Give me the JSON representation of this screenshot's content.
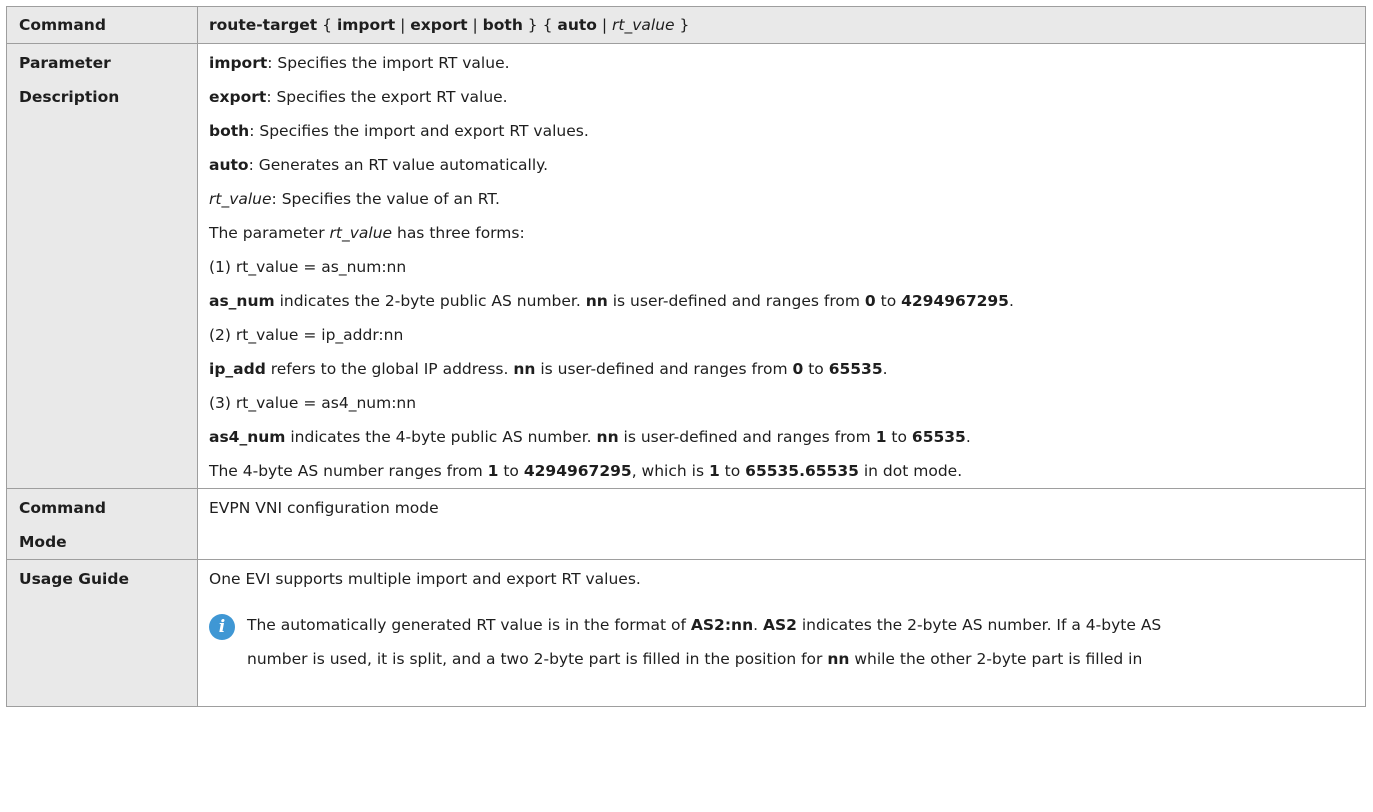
{
  "table": {
    "command_row": {
      "label": "Command",
      "kw_route_target": "route-target",
      "brace_open_1": " { ",
      "kw_import": "import",
      "sep_1": " | ",
      "kw_export": "export",
      "sep_2": " | ",
      "kw_both": "both",
      "brace_mid": " } { ",
      "kw_auto": "auto",
      "sep_3": " | ",
      "arg_rt_value": "rt_value",
      "brace_close": " }"
    },
    "param_row": {
      "label_line1": "Parameter",
      "label_line2": "Description",
      "l1_kw": "import",
      "l1_text": ": Specifies the import RT value.",
      "l2_kw": "export",
      "l2_text": ": Specifies the export RT value.",
      "l3_kw": "both",
      "l3_text": ": Specifies the import and export RT values.",
      "l4_kw": "auto",
      "l4_text": ": Generates an RT value automatically.",
      "l5_arg": "rt_value",
      "l5_text": ": Specifies the value of an RT.",
      "l6_pre": "The parameter ",
      "l6_arg": "rt_value",
      "l6_post": " has three forms:",
      "l7": "(1) rt_value = as_num:nn",
      "l8_kw1": "as_num",
      "l8_t1": " indicates the 2-byte public AS number. ",
      "l8_kw2": "nn",
      "l8_t2": " is user-defined and ranges from ",
      "l8_v1": "0",
      "l8_t3": " to ",
      "l8_v2": "4294967295",
      "l8_t4": ".",
      "l9": "(2) rt_value = ip_addr:nn",
      "l10_kw1": "ip_add",
      "l10_t1": " refers to the global IP address. ",
      "l10_kw2": "nn",
      "l10_t2": " is user-defined and ranges from ",
      "l10_v1": "0",
      "l10_t3": " to ",
      "l10_v2": "65535",
      "l10_t4": ".",
      "l11": "(3) rt_value = as4_num:nn",
      "l12_kw1": "as4_num",
      "l12_t1": " indicates the 4-byte public AS number. ",
      "l12_kw2": "nn",
      "l12_t2": " is user-defined and ranges from ",
      "l12_v1": "1",
      "l12_t3": " to ",
      "l12_v2": "65535",
      "l12_t4": ".",
      "l13_t1": "The 4-byte AS number ranges from ",
      "l13_v1": "1",
      "l13_t2": " to ",
      "l13_v2": "4294967295",
      "l13_t3": ", which is ",
      "l13_v3": "1",
      "l13_t4": " to ",
      "l13_v4": "65535.65535",
      "l13_t5": " in dot mode."
    },
    "mode_row": {
      "label_line1": "Command",
      "label_line2": "Mode",
      "text": "EVPN VNI configuration mode"
    },
    "usage_row": {
      "label": "Usage Guide",
      "text": "One EVI supports multiple import and export RT values.",
      "note_icon_glyph": "i",
      "note_l1_t1": "The automatically generated RT value is in the format of ",
      "note_l1_b1": "AS2:nn",
      "note_l1_t2": ". ",
      "note_l1_b2": "AS2",
      "note_l1_t3": " indicates the 2-byte AS number. If a 4-byte AS",
      "note_l2_t1": "number is used, it is split, and a two 2-byte part is filled in the position for ",
      "note_l2_b1": "nn",
      "note_l2_t2": " while the other 2-byte part is filled in"
    }
  }
}
